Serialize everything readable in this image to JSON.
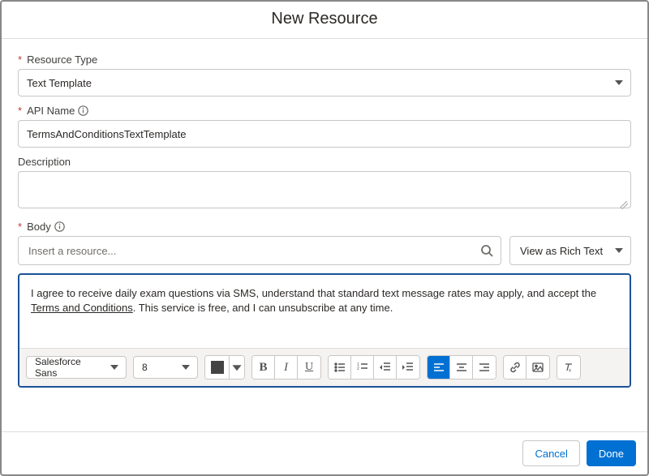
{
  "header": {
    "title": "New Resource"
  },
  "fields": {
    "resourceType": {
      "label": "Resource Type",
      "required": true,
      "value": "Text Template"
    },
    "apiName": {
      "label": "API Name",
      "required": true,
      "value": "TermsAndConditionsTextTemplate"
    },
    "description": {
      "label": "Description",
      "required": false,
      "value": ""
    },
    "body": {
      "label": "Body",
      "required": true
    }
  },
  "bodyArea": {
    "resourceSearchPlaceholder": "Insert a resource...",
    "viewModeLabel": "View as Rich Text",
    "content": {
      "prefix": "I agree to receive daily exam questions via SMS, understand that standard text message rates may apply, and accept the ",
      "link": "Terms and Conditions",
      "suffix": ". This service is free, and I can unsubscribe at any time."
    }
  },
  "toolbar": {
    "fontFamily": "Salesforce Sans",
    "fontSize": "8",
    "color": "#444444"
  },
  "footer": {
    "cancel": "Cancel",
    "done": "Done"
  }
}
